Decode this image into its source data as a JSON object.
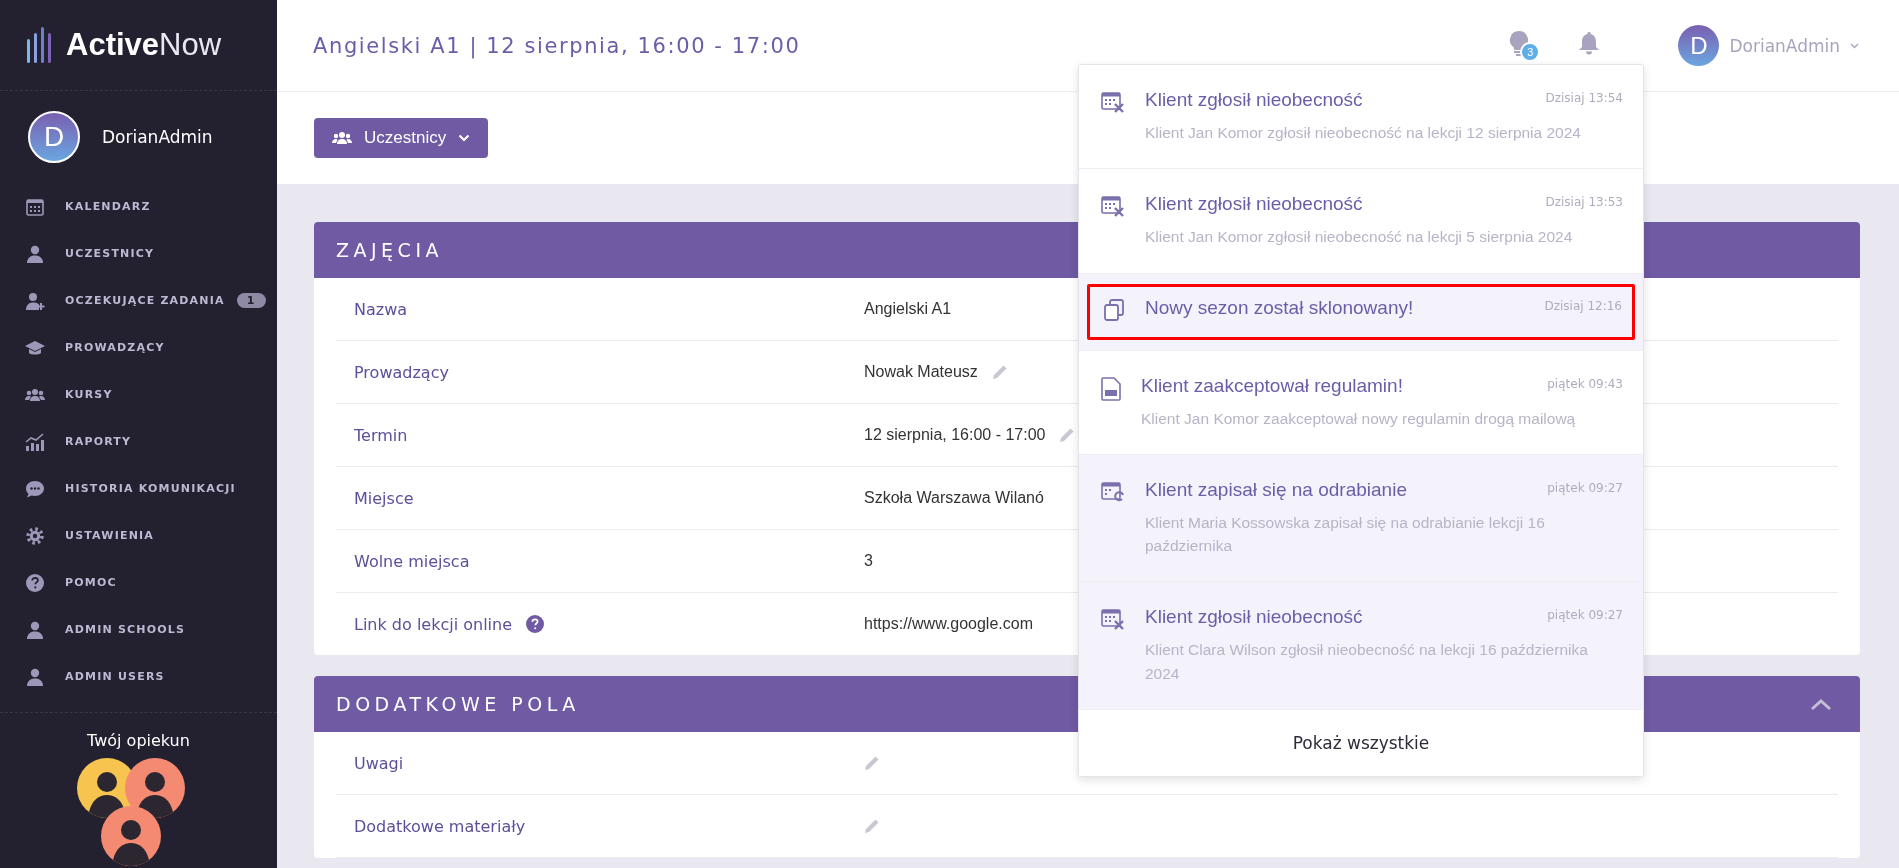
{
  "sidebar": {
    "logo": {
      "bold": "Active",
      "light": "Now"
    },
    "user": {
      "initial": "D",
      "name": "DorianAdmin"
    },
    "items": [
      {
        "label": "KALENDARZ"
      },
      {
        "label": "UCZESTNICY"
      },
      {
        "label": "OCZEKUJĄCE ZADANIA",
        "badge": "1"
      },
      {
        "label": "PROWADZĄCY"
      },
      {
        "label": "KURSY"
      },
      {
        "label": "RAPORTY"
      },
      {
        "label": "HISTORIA KOMUNIKACJI"
      },
      {
        "label": "USTAWIENIA"
      },
      {
        "label": "POMOC"
      },
      {
        "label": "ADMIN SCHOOLS"
      },
      {
        "label": "ADMIN USERS"
      }
    ],
    "caretaker_title": "Twój opiekun"
  },
  "header": {
    "title": "Angielski A1 | 12 sierpnia, 16:00 - 17:00",
    "tips_count": "3",
    "user": {
      "initial": "D",
      "name": "DorianAdmin"
    }
  },
  "toolbar": {
    "button": "Uczestnicy"
  },
  "sections": [
    {
      "title": "ZAJĘCIA",
      "collapsible": false,
      "rows": [
        {
          "label": "Nazwa",
          "value": "Angielski A1",
          "editable": false
        },
        {
          "label": "Prowadzący",
          "value": "Nowak Mateusz",
          "editable": true
        },
        {
          "label": "Termin",
          "value": "12 sierpnia, 16:00 - 17:00",
          "editable": true
        },
        {
          "label": "Miejsce",
          "value": "Szkoła Warszawa Wilanó",
          "editable": false
        },
        {
          "label": "Wolne miejsca",
          "value": "3",
          "editable": false
        },
        {
          "label": "Link do lekcji online",
          "value": "https://www.google.com",
          "editable": false,
          "help": true
        }
      ]
    },
    {
      "title": "DODATKOWE POLA",
      "collapsible": true,
      "rows": [
        {
          "label": "Uwagi",
          "editable": true
        },
        {
          "label": "Dodatkowe materiały",
          "editable": true
        }
      ]
    }
  ],
  "notifications": {
    "items": [
      {
        "kind": "absence",
        "title": "Klient zgłosił nieobecność",
        "time": "Dzisiaj 13:54",
        "text": "Klient Jan Komor zgłosił nieobecność na lekcji 12 sierpnia 2024",
        "shaded": false,
        "highlighted": false
      },
      {
        "kind": "absence",
        "title": "Klient zgłosił nieobecność",
        "time": "Dzisiaj 13:53",
        "text": "Klient Jan Komor zgłosił nieobecność na lekcji 5 sierpnia 2024",
        "shaded": false,
        "highlighted": false
      },
      {
        "kind": "clone",
        "title": "Nowy sezon został sklonowany!",
        "time": "Dzisiaj 12:16",
        "shaded": true,
        "highlighted": true
      },
      {
        "kind": "document",
        "title": "Klient zaakceptował regulamin!",
        "time": "piątek 09:43",
        "text": "Klient Jan Komor zaakceptował nowy regulamin drogą mailową",
        "shaded": false,
        "highlighted": false
      },
      {
        "kind": "makeup",
        "title": "Klient zapisał się na odrabianie",
        "time": "piątek 09:27",
        "text": "Klient Maria Kossowska zapisał się na odrabianie lekcji 16 października",
        "shaded": true,
        "highlighted": false
      },
      {
        "kind": "absence",
        "title": "Klient zgłosił nieobecność",
        "time": "piątek 09:27",
        "text": "Klient Clara Wilson zgłosił nieobecność na lekcji 16 października 2024",
        "shaded": true,
        "highlighted": false
      }
    ],
    "footer": "Pokaż wszystkie"
  }
}
